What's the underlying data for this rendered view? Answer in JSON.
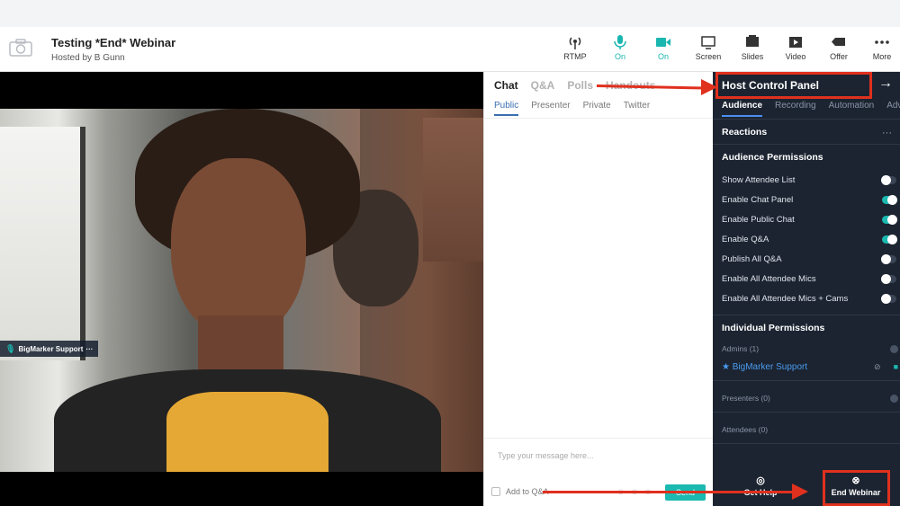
{
  "header": {
    "title": "Testing *End* Webinar",
    "host": "Hosted by B Gunn",
    "tools": [
      {
        "label": "RTMP",
        "icon": "broadcast-icon",
        "on": false
      },
      {
        "label": "On",
        "icon": "microphone-icon",
        "on": true
      },
      {
        "label": "On",
        "icon": "video-camera-icon",
        "on": true
      },
      {
        "label": "Screen",
        "icon": "monitor-icon",
        "on": false
      },
      {
        "label": "Slides",
        "icon": "slides-icon",
        "on": false
      },
      {
        "label": "Video",
        "icon": "play-video-icon",
        "on": false
      },
      {
        "label": "Offer",
        "icon": "offer-tag-icon",
        "on": false
      },
      {
        "label": "More",
        "icon": "more-dots-icon",
        "on": false
      }
    ]
  },
  "video": {
    "presenter_label": "BigMarker Support"
  },
  "chat": {
    "tabs": [
      "Chat",
      "Q&A",
      "Polls",
      "Handouts"
    ],
    "subtabs": [
      "Public",
      "Presenter",
      "Private",
      "Twitter"
    ],
    "placeholder": "Type your message here...",
    "add_to_qa": "Add to Q&A",
    "send_label": "Send"
  },
  "panel": {
    "title": "Host Control Panel",
    "tabs": [
      "Audience",
      "Recording",
      "Automation",
      "Adv"
    ],
    "reactions": "Reactions",
    "audience_permissions": "Audience Permissions",
    "permissions": [
      {
        "label": "Show Attendee List",
        "on": false
      },
      {
        "label": "Enable Chat Panel",
        "on": true
      },
      {
        "label": "Enable Public Chat",
        "on": true
      },
      {
        "label": "Enable Q&A",
        "on": true
      },
      {
        "label": "Publish All Q&A",
        "on": false
      },
      {
        "label": "Enable All Attendee Mics",
        "on": false
      },
      {
        "label": "Enable All Attendee Mics + Cams",
        "on": false
      }
    ],
    "individual_permissions": "Individual Permissions",
    "admins": "Admins (1)",
    "admin_name": "★ BigMarker Support",
    "presenters": "Presenters (0)",
    "attendees": "Attendees (0)",
    "get_help": "Get Help",
    "end_webinar": "End Webinar"
  },
  "colors": {
    "accent": "#1bb9b0",
    "panel_bg": "#1c2431",
    "annotation_red": "#e0301e",
    "link_blue": "#4a9cf0"
  }
}
